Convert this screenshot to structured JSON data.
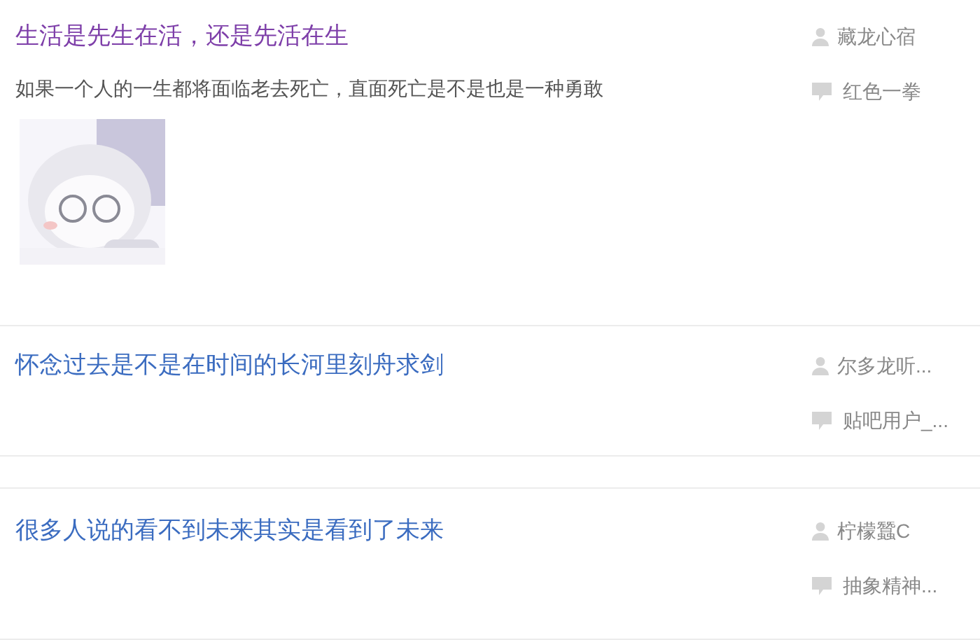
{
  "threads": [
    {
      "title": "生活是先生在活，还是先活在生",
      "visited": true,
      "abstract": "如果一个人的一生都将面临老去死亡，直面死亡是不是也是一种勇敢",
      "author": "藏龙心宿",
      "last_reply": "红色一拳"
    },
    {
      "title": "怀念过去是不是在时间的长河里刻舟求剑",
      "visited": false,
      "author": "尔多龙听...",
      "last_reply": "贴吧用户_..."
    },
    {
      "title": "很多人说的看不到未来其实是看到了未来",
      "visited": false,
      "author": "柠檬蠶C",
      "last_reply": "抽象精神..."
    }
  ]
}
